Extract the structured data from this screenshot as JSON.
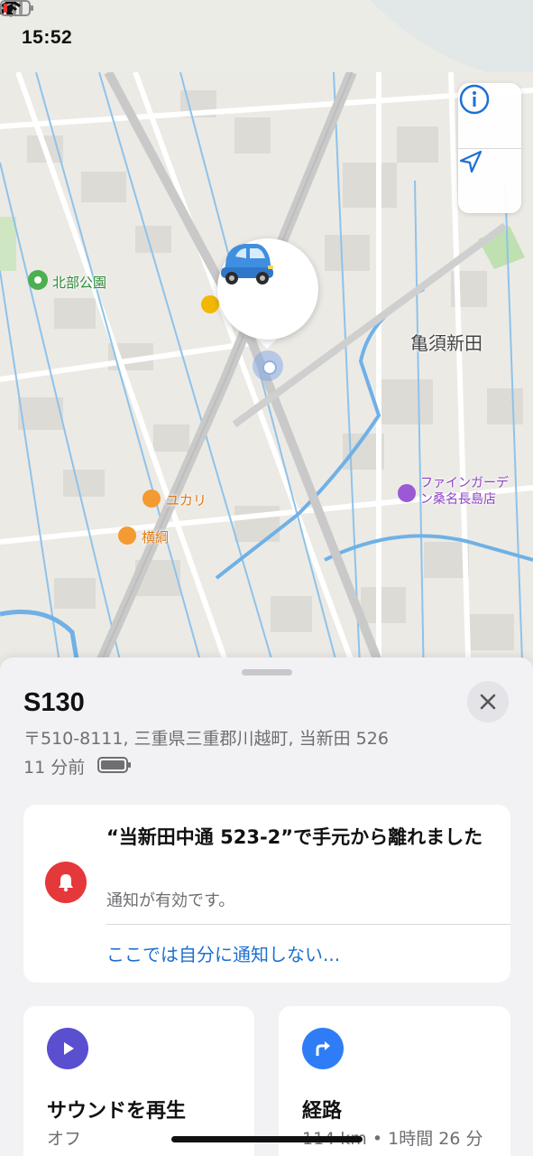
{
  "status_bar": {
    "time": "15:52"
  },
  "map": {
    "labels": {
      "park": "北部公園",
      "district": "亀須新田",
      "shop": "ファインガーデン桑名長島店",
      "shop_line1": "ファインガーデ",
      "shop_line2": "ン桑名長島店",
      "cafe1": "ユカリ",
      "cafe2": "横綱"
    },
    "icons": {
      "info": "info-icon",
      "locate": "location-arrow-icon",
      "device": "car-icon"
    }
  },
  "sheet": {
    "device_name": "S130",
    "address": "〒510-8111, 三重県三重郡川越町, 当新田 526",
    "last_seen": "11 分前"
  },
  "alert_card": {
    "title": "“当新田中通 523-2”で手元から離れました",
    "subtitle": "通知が有効です。",
    "link": "ここでは自分に通知しない..."
  },
  "sound_card": {
    "title": "サウンドを再生",
    "status": "オフ"
  },
  "route_card": {
    "title": "経路",
    "detail": "114 km • 1時間 26 分"
  },
  "colors": {
    "accent_blue": "#1e6fd1",
    "alert_red": "#e5383b",
    "play_purple": "#5a4fcf",
    "route_blue": "#2f7df6"
  }
}
